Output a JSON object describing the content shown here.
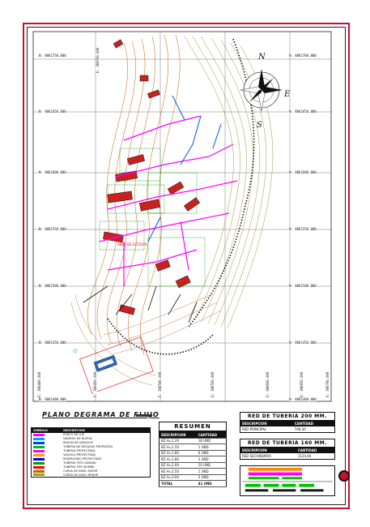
{
  "plan": {
    "title": "PLANO DEGRAMA DE FLUJO",
    "area_label": "AREA DE ESTUDIO"
  },
  "compass": {
    "north": "N",
    "east": "E",
    "south": "S"
  },
  "grid_labels": {
    "north_left": [
      "N: 8861750.000",
      "N: 8861650.000",
      "N: 8861600.000",
      "N: 8861550.000",
      "N: 8861500.000",
      "N: 8861450.000",
      "N: 8861400.000"
    ],
    "north_right": [
      "N: 8861700.000",
      "N: 8861650.000",
      "N: 8861600.000",
      "N: 8861550.000",
      "N: 8861500.000",
      "N: 8861450.000",
      "N: 8861400.000"
    ],
    "east_bottom": [
      "E: 366400.000",
      "E: 366450.000",
      "E: 366500.000",
      "E: 366550.000",
      "E: 366600.000",
      "E: 366650.000",
      "E: 366700.000"
    ],
    "east_top": [
      "E: 366500.000"
    ]
  },
  "legend": {
    "header": [
      "SIMBOLO",
      "DESCRIPCION"
    ],
    "items": [
      {
        "desc": "PUNTO DE LUZ",
        "color": "#ff00ff"
      },
      {
        "desc": "NUMERO DE BUZON",
        "color": "#00a0ff"
      },
      {
        "desc": "BUZON DE DESAGUE",
        "color": "#0040ff"
      },
      {
        "desc": "TUBERIA DE DESAGUE PROPUESTA",
        "color": "#00c000"
      },
      {
        "desc": "TUBERIA PROYECTADA",
        "color": "#ff00ff"
      },
      {
        "desc": "VALVULA PROYECTADA",
        "color": "#ffa000"
      },
      {
        "desc": "RESERVORIO PROYECTADO",
        "color": "#0000ff"
      },
      {
        "desc": "TUBERIA TIPO CAMARA",
        "color": "#00a000"
      },
      {
        "desc": "TUBERIA TIPO BOMBA",
        "color": "#ff0000"
      },
      {
        "desc": "CURVA DE NIVEL MAYOR",
        "color": "#c06000"
      },
      {
        "desc": "CURVA DE NIVEL MENOR",
        "color": "#a0a000"
      }
    ]
  },
  "summary": {
    "title": "RESUMEN",
    "header": [
      "DESCRIPCION",
      "CANTIDAD"
    ],
    "rows": [
      [
        "BZ H=1.20",
        "18 UND"
      ],
      [
        "BZ H=1.50",
        "1 UND"
      ],
      [
        "BZ H=1.80",
        "6 UND"
      ],
      [
        "BZ H=1.80",
        "3 UND"
      ],
      [
        "BZ H=2.00",
        "10 UND"
      ],
      [
        "BZ H=2.50",
        "1 UND"
      ],
      [
        "BZ H=3.00",
        "3 UND"
      ],
      [
        "TOTAL",
        "41 UND"
      ]
    ]
  },
  "net1": {
    "title": "RED DE TUBERIA 200 MM.",
    "header": [
      "DESCRIPCION",
      "CANTIDAD"
    ],
    "rows": [
      [
        "RED PRINCIPAL",
        "748.30"
      ]
    ]
  },
  "net2": {
    "title": "RED DE TUBERIA 160 MM.",
    "header": [
      "DESCRIPCION",
      "CANTIDAD"
    ],
    "rows": [
      [
        "RED SECUNDARIA",
        "1124.84"
      ]
    ]
  },
  "colors": {
    "contour_major": "#c06000",
    "contour_minor": "#8a7a00",
    "pipe": "#ff00ff",
    "building": "#cc2020",
    "network": "#0050ff"
  }
}
